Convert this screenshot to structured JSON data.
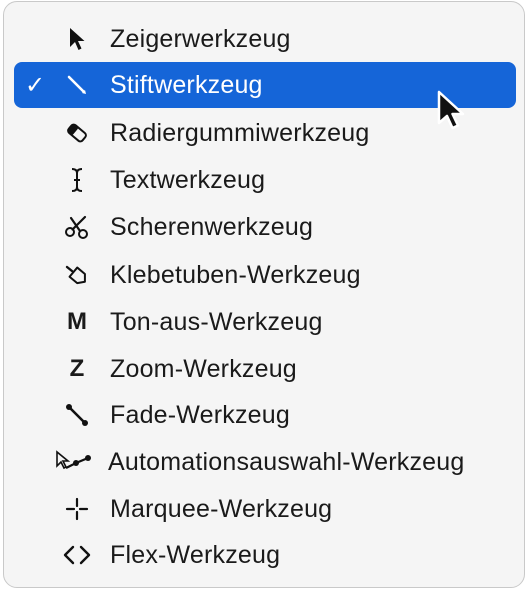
{
  "menu": {
    "items": [
      {
        "label": "Zeigerwerkzeug",
        "icon": "pointer-arrow-icon",
        "selected": false
      },
      {
        "label": "Stiftwerkzeug",
        "icon": "pencil-icon",
        "selected": true,
        "check": "✓"
      },
      {
        "label": "Radiergummiwerkzeug",
        "icon": "eraser-icon",
        "selected": false
      },
      {
        "label": "Textwerkzeug",
        "icon": "text-cursor-icon",
        "selected": false
      },
      {
        "label": "Scherenwerkzeug",
        "icon": "scissors-icon",
        "selected": false
      },
      {
        "label": "Klebetuben-Werkzeug",
        "icon": "glue-tube-icon",
        "selected": false
      },
      {
        "label": "Ton-aus-Werkzeug",
        "icon": "mute-icon",
        "glyph": "M",
        "selected": false
      },
      {
        "label": "Zoom-Werkzeug",
        "icon": "zoom-icon",
        "glyph": "Z",
        "selected": false
      },
      {
        "label": "Fade-Werkzeug",
        "icon": "fade-icon",
        "selected": false
      },
      {
        "label": "Automationsauswahl-Werkzeug",
        "icon": "automation-select-icon",
        "selected": false
      },
      {
        "label": "Marquee-Werkzeug",
        "icon": "marquee-crosshair-icon",
        "selected": false
      },
      {
        "label": "Flex-Werkzeug",
        "icon": "flex-icon",
        "selected": false
      }
    ]
  },
  "colors": {
    "selection": "#1565d8",
    "menu_background": "#f5f5f5",
    "text": "#1a1a1a"
  }
}
